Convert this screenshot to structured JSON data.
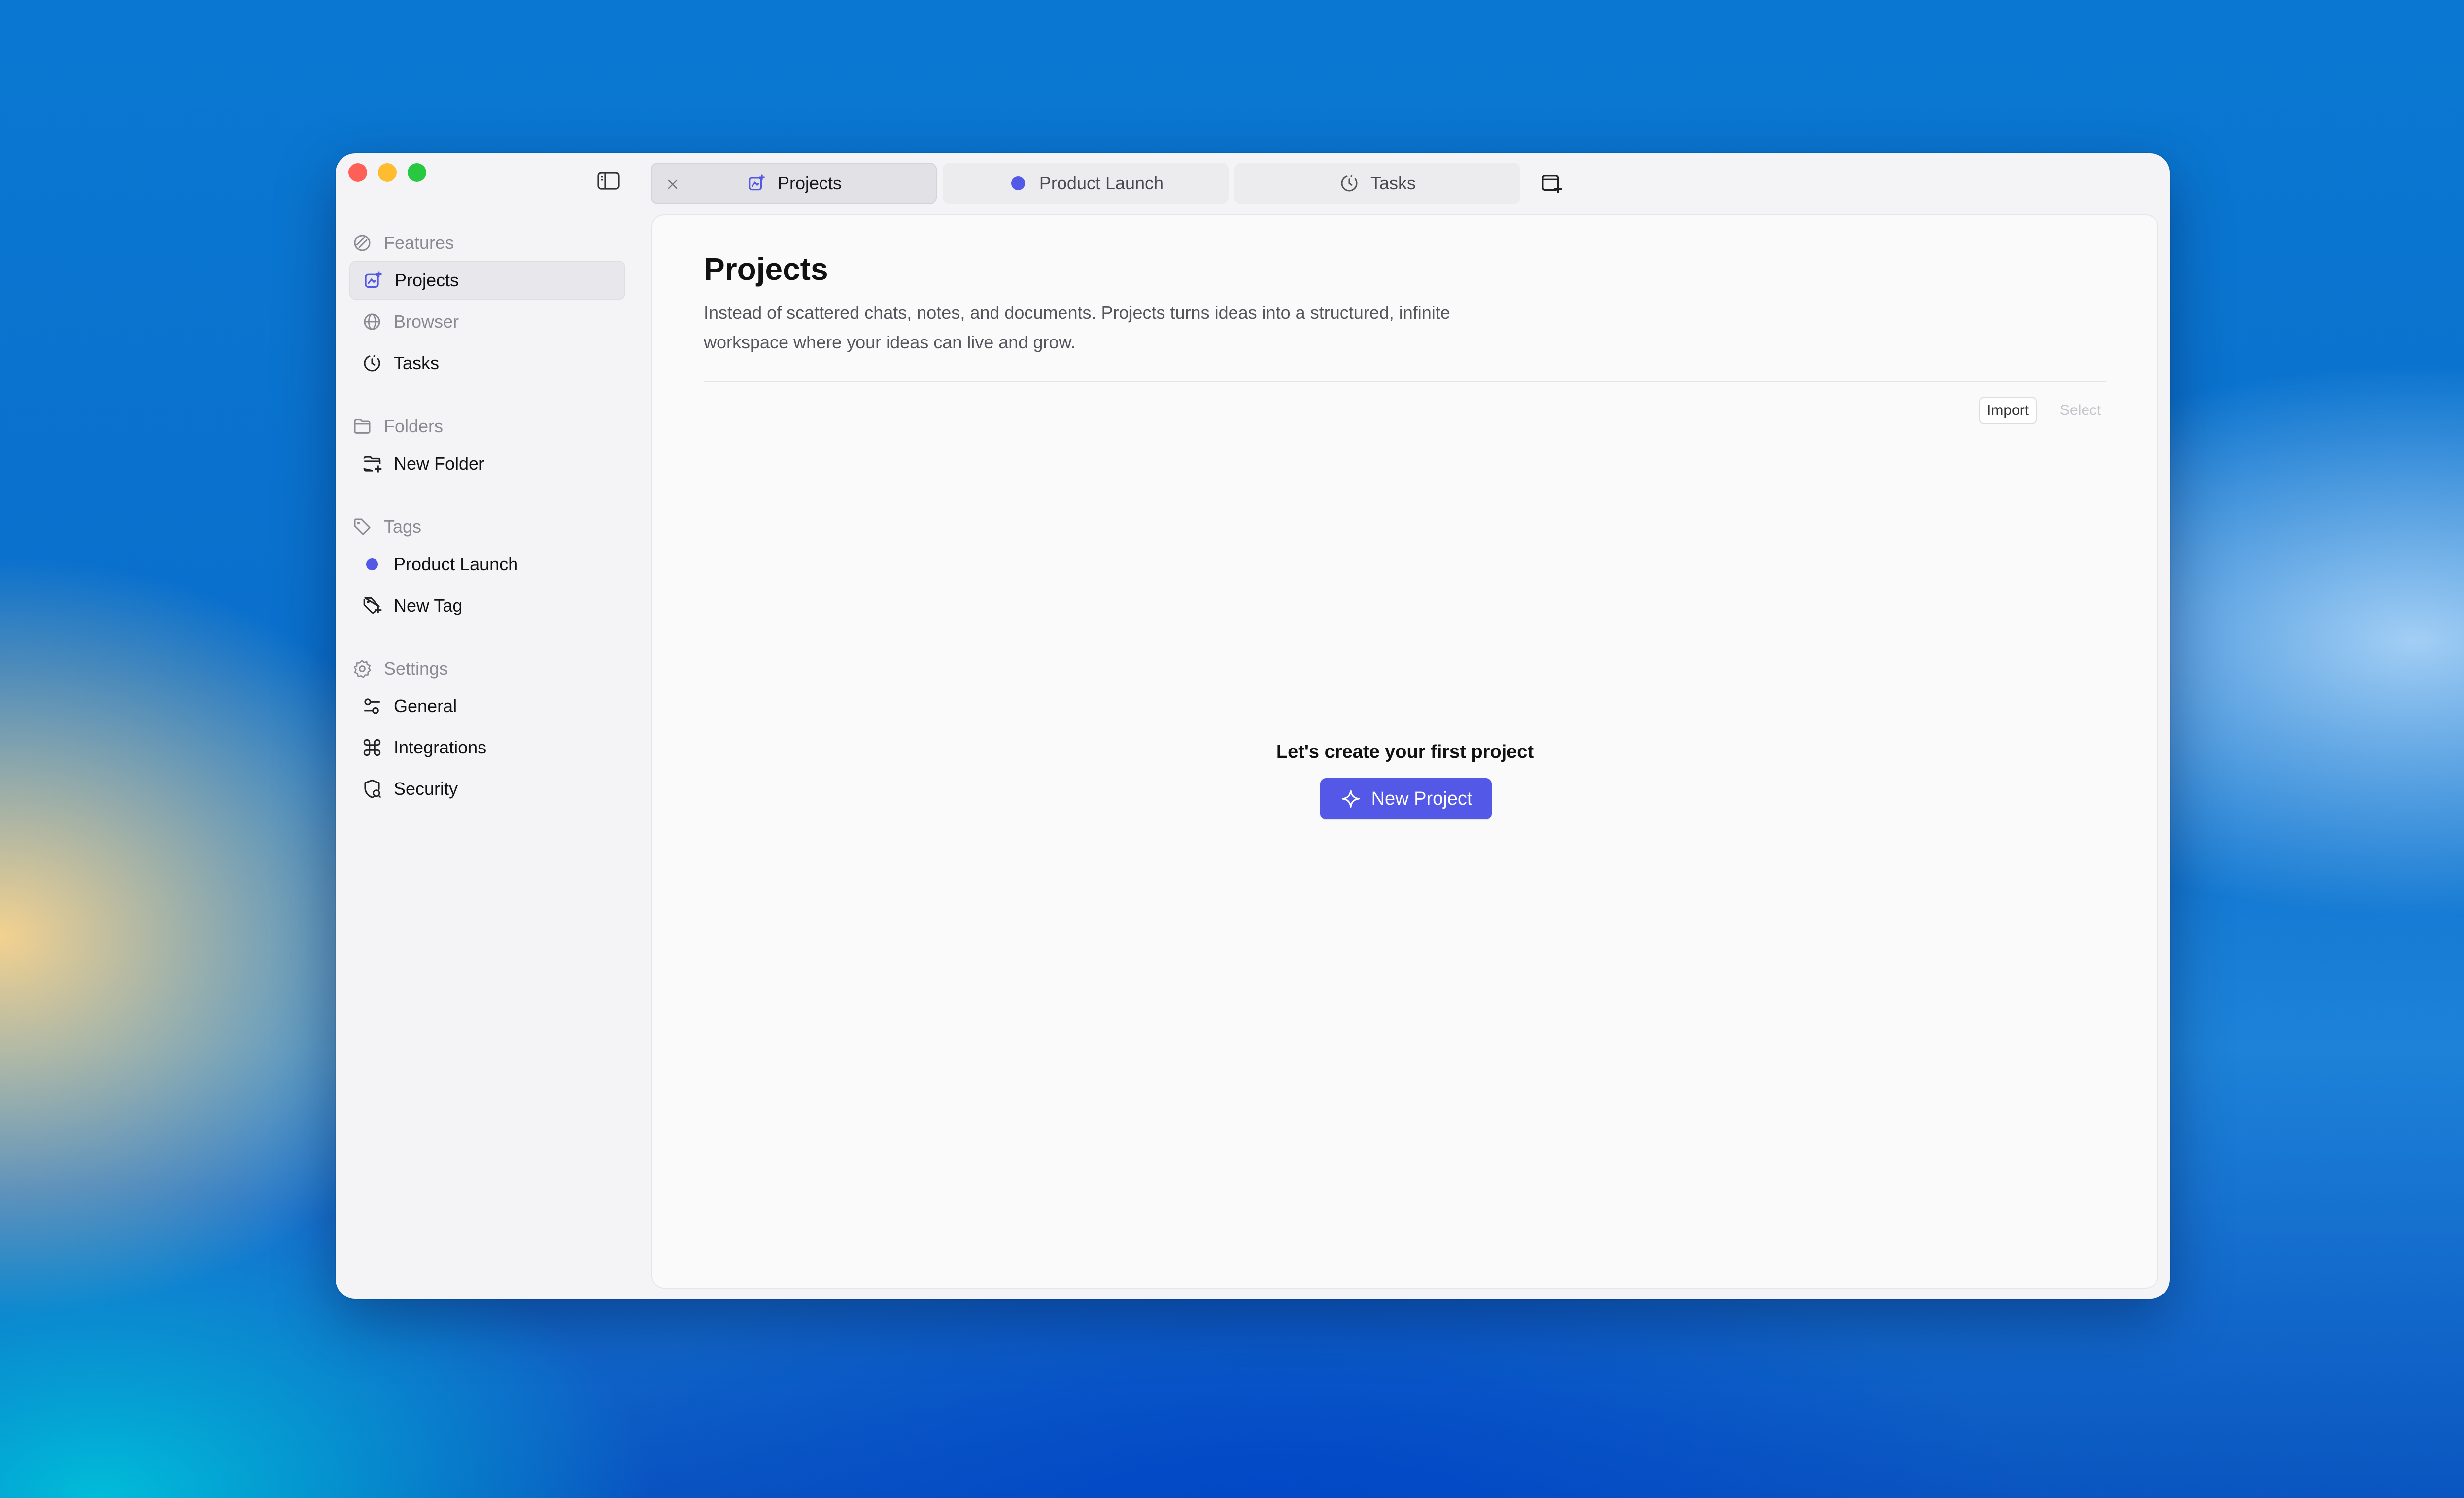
{
  "tabs": [
    {
      "label": "Projects",
      "icon": "projects-icon",
      "active": true,
      "closable": true
    },
    {
      "label": "Product Launch",
      "icon": "tag-dot-icon",
      "active": false
    },
    {
      "label": "Tasks",
      "icon": "clock-icon",
      "active": false
    }
  ],
  "sidebar": {
    "features": {
      "title": "Features",
      "items": [
        {
          "label": "Projects",
          "icon": "projects-icon",
          "active": true
        },
        {
          "label": "Browser",
          "icon": "globe-icon",
          "muted": true
        },
        {
          "label": "Tasks",
          "icon": "clock-icon"
        }
      ]
    },
    "folders": {
      "title": "Folders",
      "items": [
        {
          "label": "New Folder",
          "icon": "folder-plus-icon"
        }
      ]
    },
    "tags": {
      "title": "Tags",
      "items": [
        {
          "label": "Product Launch",
          "icon": "tag-dot-icon"
        },
        {
          "label": "New Tag",
          "icon": "tag-plus-icon"
        }
      ]
    },
    "settings": {
      "title": "Settings",
      "items": [
        {
          "label": "General",
          "icon": "sliders-icon"
        },
        {
          "label": "Integrations",
          "icon": "command-icon"
        },
        {
          "label": "Security",
          "icon": "shield-icon"
        }
      ]
    }
  },
  "main": {
    "title": "Projects",
    "description": "Instead of scattered chats, notes, and documents. Projects turns ideas into a structured, infinite workspace where your ideas can live and grow.",
    "import_label": "Import",
    "select_label": "Select",
    "empty_title": "Let's create your first project",
    "new_project_label": "New Project"
  },
  "colors": {
    "accent": "#5458e6",
    "tag_product_launch": "#5458e6"
  }
}
